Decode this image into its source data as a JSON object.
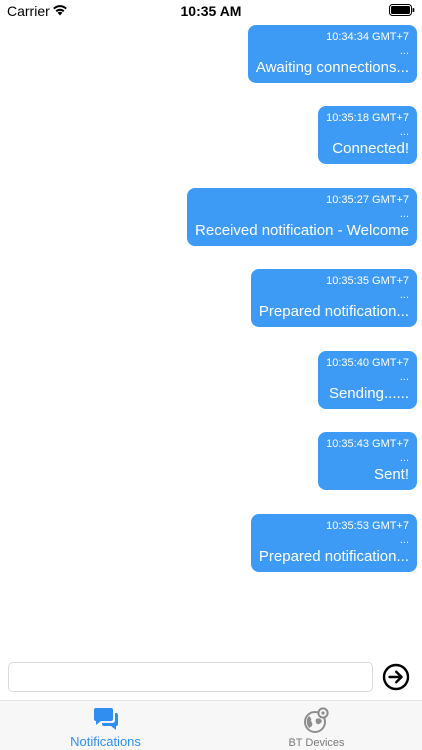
{
  "status_bar": {
    "carrier": "Carrier",
    "time": "10:35 AM"
  },
  "messages": [
    {
      "time": "10:34:34 GMT+7",
      "dots": "...",
      "text": "Awaiting connections..."
    },
    {
      "time": "10:35:18 GMT+7",
      "dots": "...",
      "text": "Connected!"
    },
    {
      "time": "10:35:27 GMT+7",
      "dots": "...",
      "text": "Received notification - Welcome"
    },
    {
      "time": "10:35:35 GMT+7",
      "dots": "...",
      "text": "Prepared notification..."
    },
    {
      "time": "10:35:40 GMT+7",
      "dots": "...",
      "text": "Sending......"
    },
    {
      "time": "10:35:43 GMT+7",
      "dots": "...",
      "text": "Sent!"
    },
    {
      "time": "10:35:53 GMT+7",
      "dots": "...",
      "text": "Prepared notification..."
    }
  ],
  "composer": {
    "value": "",
    "send_icon": "arrow-circle-right-icon"
  },
  "tabs": [
    {
      "label": "Notifications",
      "icon": "chat-bubbles-icon",
      "selected": true
    },
    {
      "label": "BT Devices",
      "icon": "globe-location-icon",
      "selected": false
    }
  ],
  "colors": {
    "bubble": "#3d9bf5",
    "tab_active": "#2f8ef0",
    "tab_inactive": "#7a7a7a"
  }
}
